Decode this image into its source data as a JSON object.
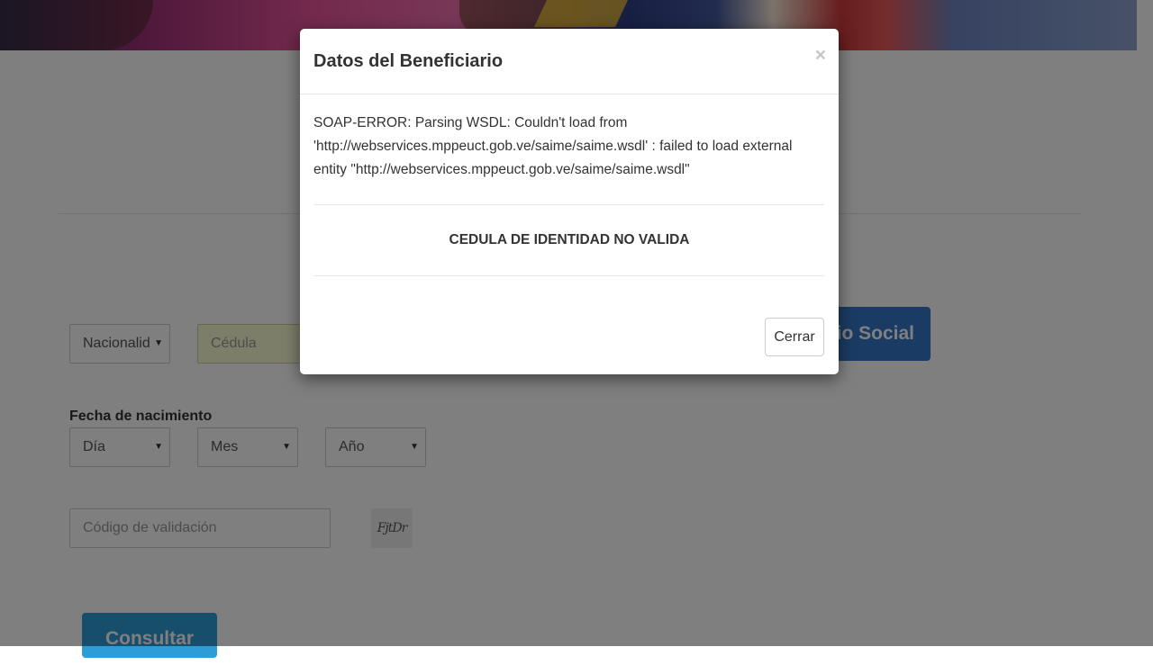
{
  "form": {
    "nacionalidad": "Nacionalid",
    "cedula_placeholder": "Cédula",
    "social_button": "orio Social",
    "fecha_label": "Fecha de nacimiento",
    "dia": "Día",
    "mes": "Mes",
    "anio": "Año",
    "codigo_placeholder": "Código de validación",
    "captcha_text": "FjtDr",
    "consultar_button": "Consultar",
    "caret": "▼"
  },
  "modal": {
    "title": "Datos del Beneficiario",
    "close_symbol": "×",
    "message": "SOAP-ERROR: Parsing WSDL: Couldn't load from 'http://webservices.mppeuct.gob.ve/saime/saime.wsdl' : failed to load external entity \"http://webservices.mppeuct.gob.ve/saime/saime.wsdl\"",
    "invalid_text": "CEDULA DE IDENTIDAD NO VALIDA",
    "close_button": "Cerrar"
  },
  "colors": {
    "primary_button": "#3477c6",
    "consultar_button": "#2e9cd7",
    "cedula_background": "#fbfcd4",
    "backdrop": "rgba(0,0,0,0.5)"
  }
}
